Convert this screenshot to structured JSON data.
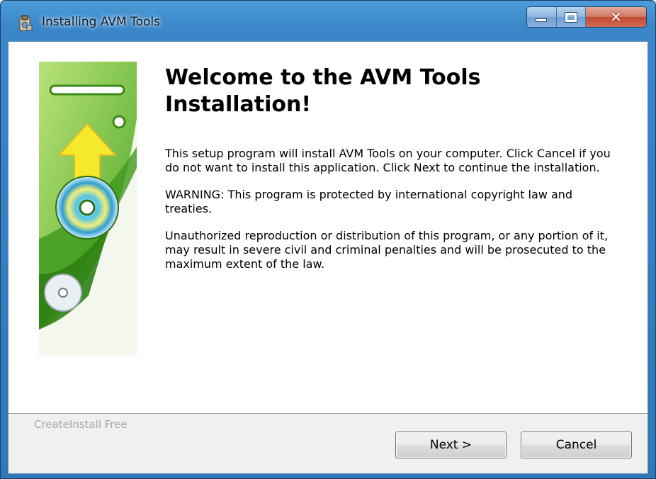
{
  "window": {
    "title": "Installing AVM Tools",
    "caption_buttons": {
      "minimize": "minimize-icon",
      "maximize": "maximize-icon",
      "close": "close-icon"
    }
  },
  "welcome": {
    "heading": "Welcome to the AVM Tools Installation!",
    "paragraphs": [
      "This setup program will install AVM Tools on your computer. Click Cancel if you do not want to install this application. Click Next to continue the installation.",
      "WARNING: This program is protected by international copyright law and treaties.",
      "Unauthorized reproduction or distribution of this program, or any portion of it, may result in severe civil and criminal penalties and will be prosecuted to the maximum extent of the law."
    ]
  },
  "footer": {
    "brand": "CreateInstall Free",
    "next_label": "Next >",
    "cancel_label": "Cancel"
  },
  "colors": {
    "banner_green": "#5cb82e",
    "arrow_yellow": "#f2e52a",
    "title_bar": "#3a86c8"
  }
}
